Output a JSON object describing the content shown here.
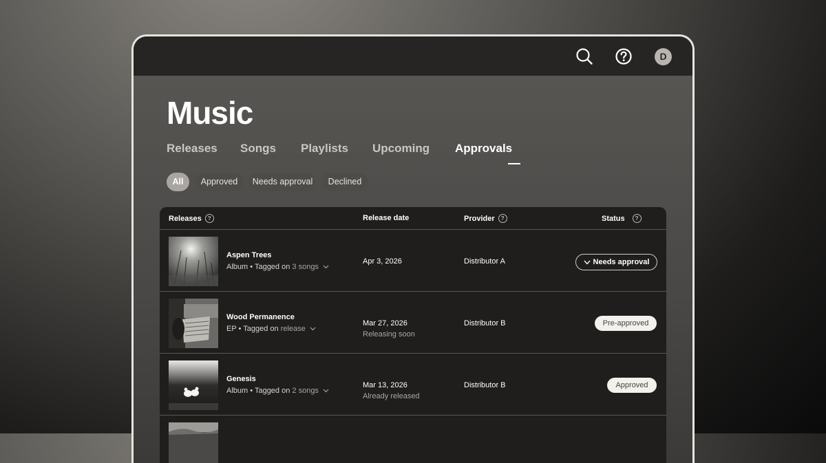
{
  "header": {
    "avatar_initial": "D",
    "icons": [
      "search-icon",
      "help-icon"
    ]
  },
  "page_title": "Music",
  "tabs": [
    {
      "label": "Releases",
      "active": false
    },
    {
      "label": "Songs",
      "active": false
    },
    {
      "label": "Playlists",
      "active": false
    },
    {
      "label": "Upcoming",
      "active": false
    },
    {
      "label": "Approvals",
      "active": true
    }
  ],
  "filters": [
    {
      "label": "All",
      "selected": true
    },
    {
      "label": "Approved",
      "selected": false
    },
    {
      "label": "Needs approval",
      "selected": false
    },
    {
      "label": "Declined",
      "selected": false
    }
  ],
  "table": {
    "columns": {
      "releases": "Releases",
      "release_date": "Release date",
      "provider": "Provider",
      "status": "Status"
    },
    "help_glyph": "?",
    "rows": [
      {
        "title": "Aspen Trees",
        "type": "Album",
        "tagged_prefix": "Tagged on",
        "tagged_link": "3 songs",
        "date": "Apr 3, 2026",
        "subdate": "",
        "provider": "Distributor A",
        "status": "Needs approval"
      },
      {
        "title": "Wood Permanence",
        "type": "EP",
        "tagged_prefix": "Tagged on",
        "tagged_link": "release",
        "date": "Mar 27, 2026",
        "subdate": "Releasing soon",
        "provider": "Distributor B",
        "status": "Pre-approved"
      },
      {
        "title": "Genesis",
        "type": "Album",
        "tagged_prefix": "Tagged on",
        "tagged_link": "2 songs",
        "date": "Mar 13, 2026",
        "subdate": "Already released",
        "provider": "Distributor B",
        "status": "Approved"
      }
    ]
  },
  "colors": {
    "accent_text": "#ffffff",
    "muted_text": "#a9a7a3",
    "table_bg": "#1f1e1d",
    "pill_bg": "#f3f1ec"
  }
}
